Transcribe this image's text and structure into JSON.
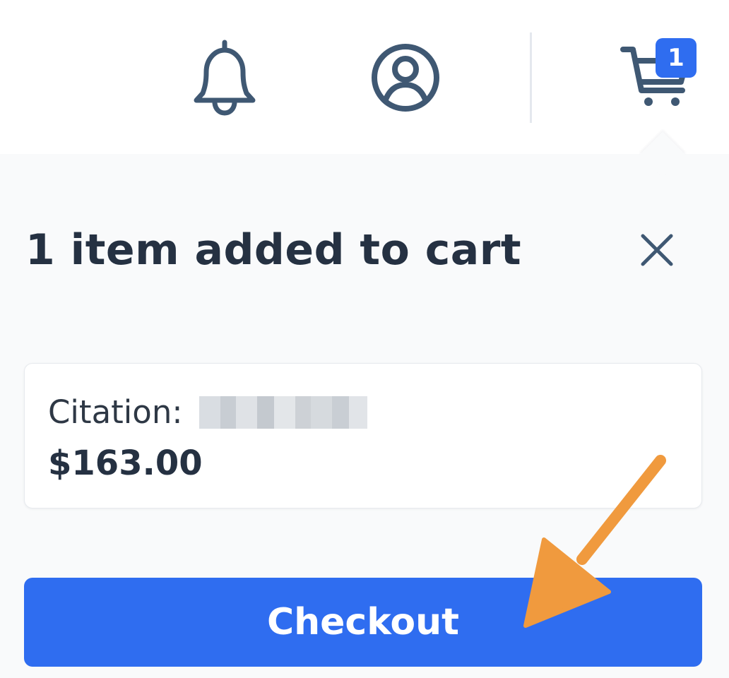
{
  "header": {
    "icons": [
      "bell-icon",
      "user-icon",
      "cart-icon"
    ],
    "cart_count": "1"
  },
  "popover": {
    "title": "1 item added to cart",
    "close_icon": "close-icon",
    "item": {
      "label": "Citation:",
      "value_redacted": true,
      "price": "$163.00"
    },
    "checkout_label": "Checkout"
  },
  "colors": {
    "accent": "#2f6df0",
    "icon": "#3f5873",
    "text_dark": "#253142",
    "popover_bg": "#f9fafb",
    "annotation_arrow": "#f09a3e"
  }
}
